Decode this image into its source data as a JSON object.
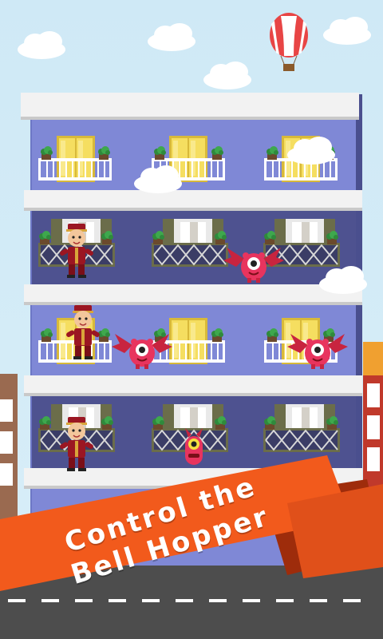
{
  "promo": {
    "caption_line1": "Control the",
    "caption_line2": "Bell Hopper"
  },
  "colors": {
    "sky": "#cfe9f6",
    "building_wall": "#7f88d6",
    "dark_floor_wall": "#4e5290",
    "ledge": "#f2f2f2",
    "window_yellow": "#f5de60",
    "banner_orange": "#f25a1c",
    "banner_dark": "#9e2c0b",
    "bellhop_uniform": "#9b1622",
    "monster_pink": "#e8345e",
    "road": "#4d4d4d"
  },
  "sprites": {
    "player": "bellhop-character",
    "enemies": [
      "winged-pink-monster",
      "winged-pink-monster",
      "winged-pink-monster",
      "one-eyed-pink-monster"
    ],
    "decor": [
      "hot-air-balloon",
      "cloud"
    ]
  }
}
